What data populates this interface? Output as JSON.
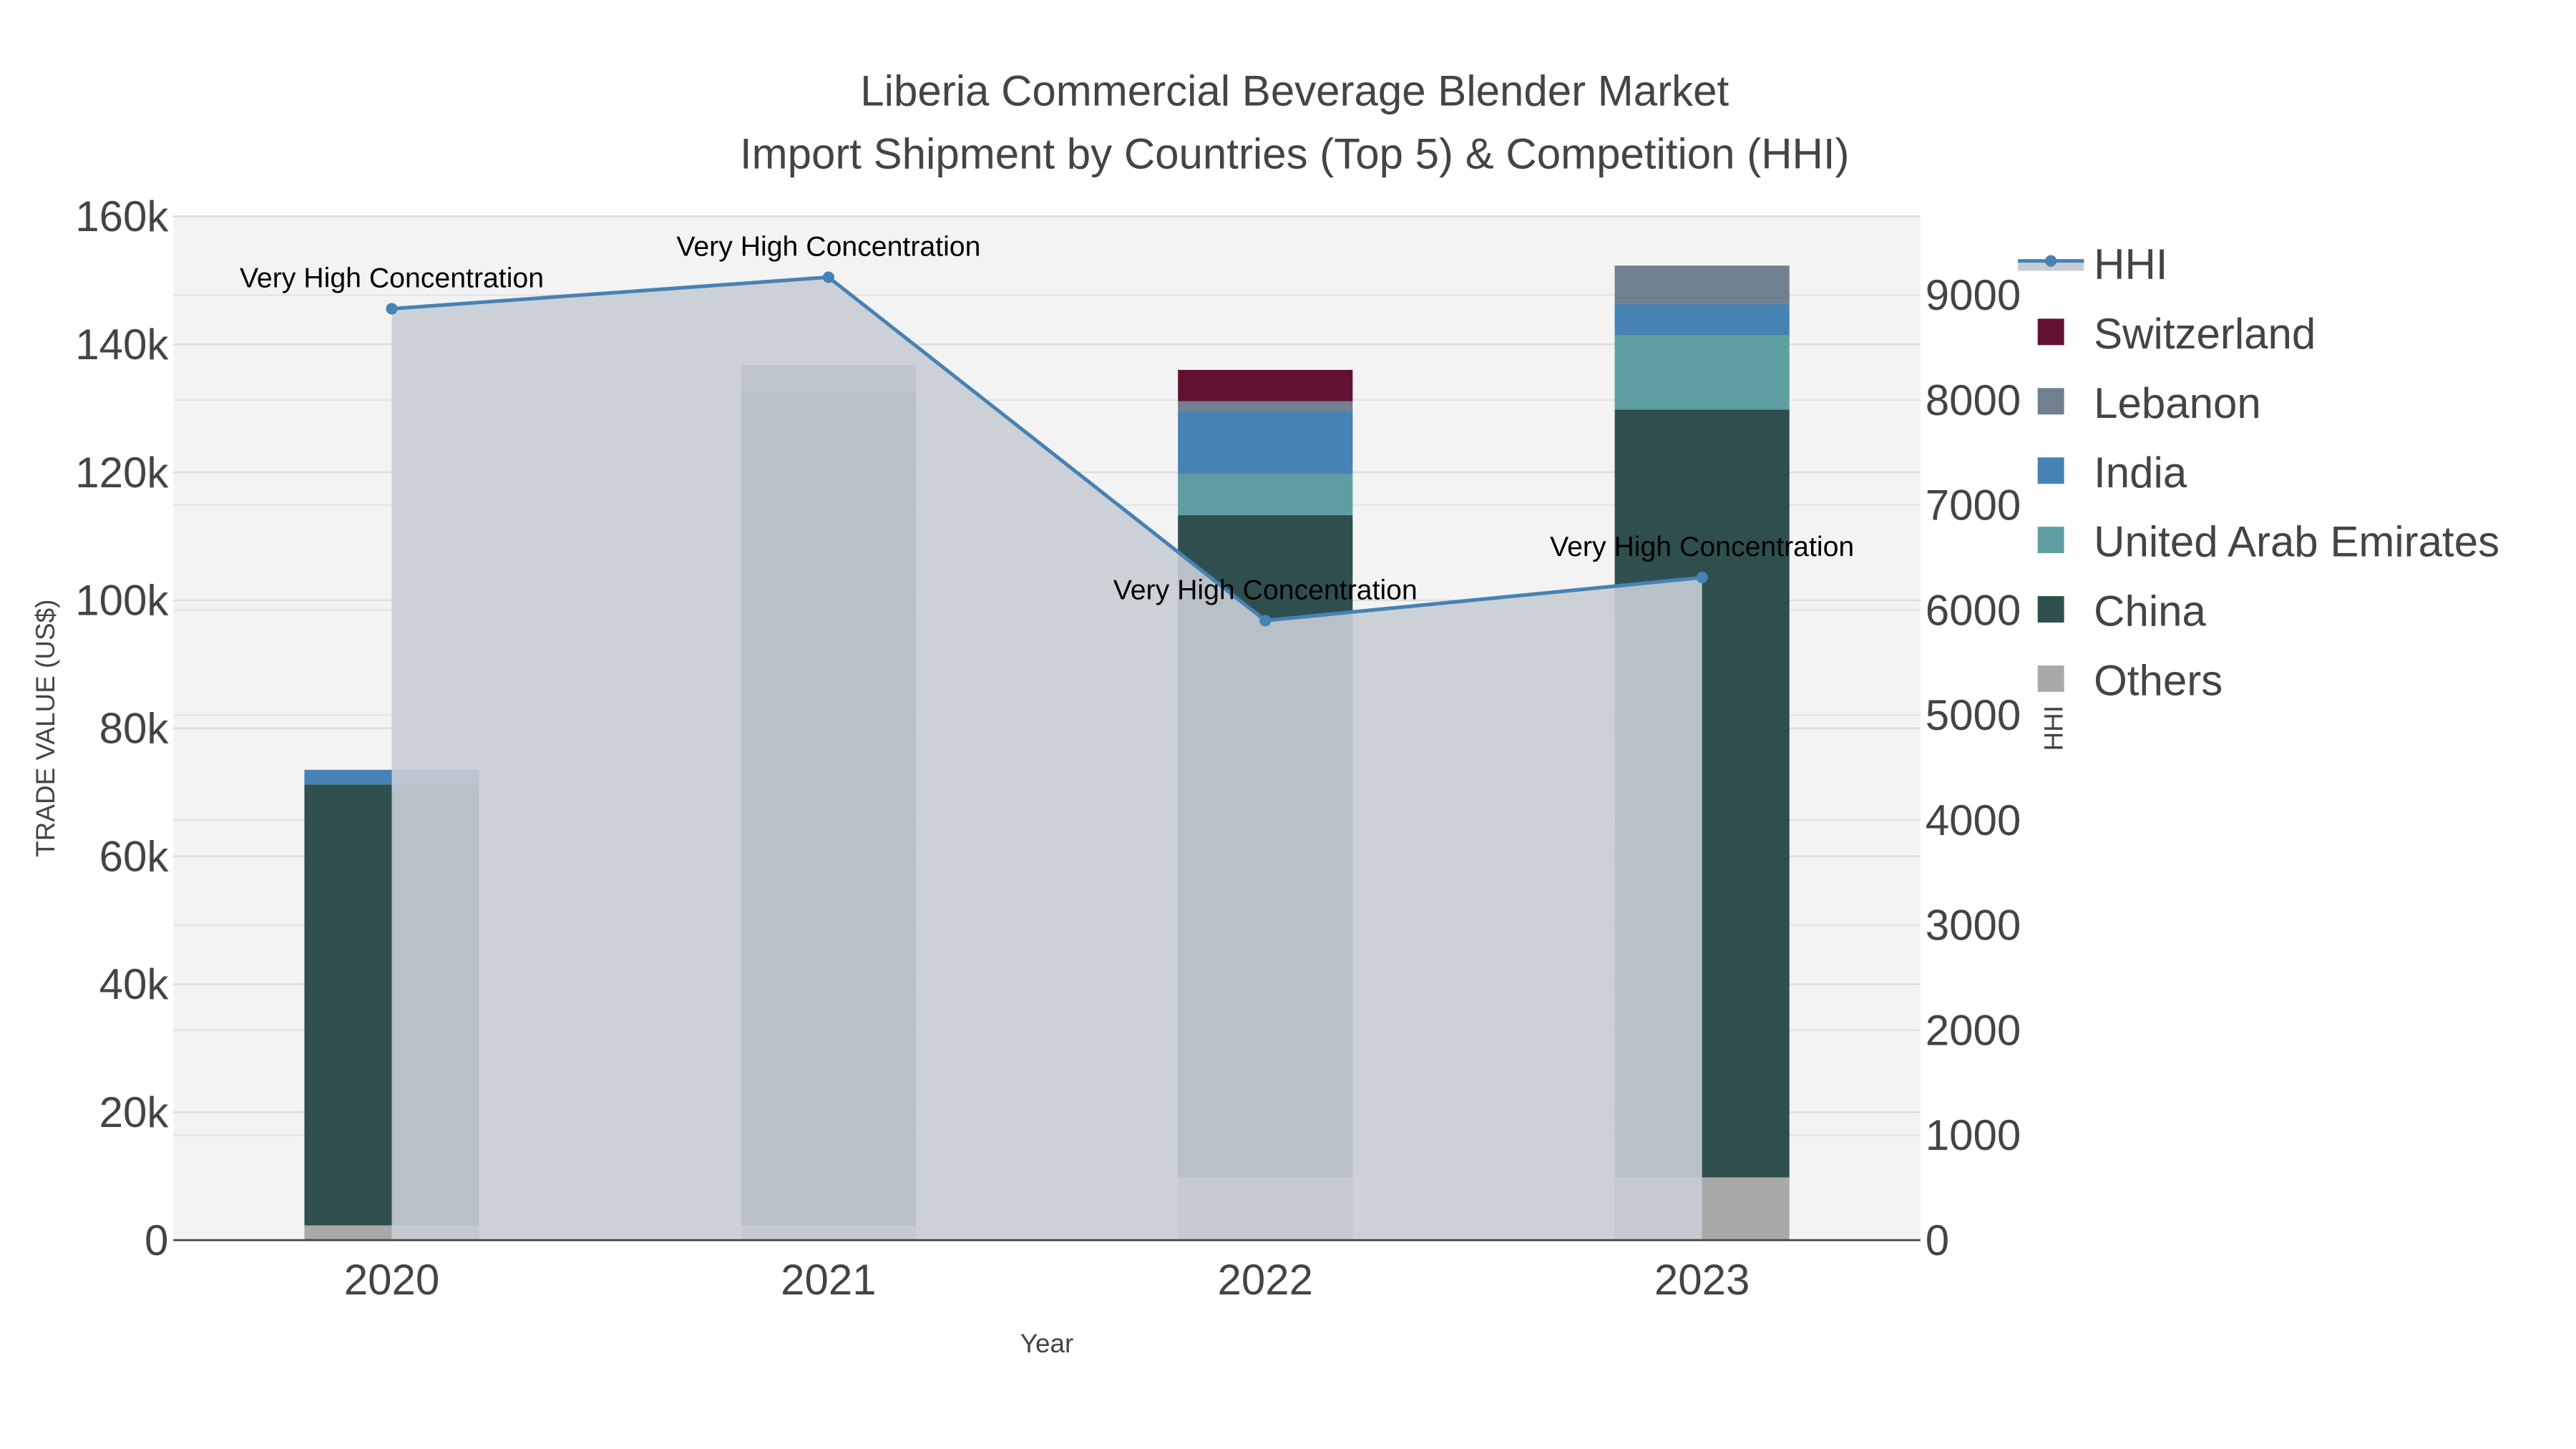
{
  "chart_data": {
    "type": "bar",
    "title": "Liberia Commercial Beverage Blender Market",
    "subtitle": "Import Shipment by Countries (Top 5) & Competition (HHI)",
    "xlabel": "Year",
    "ylabel": "TRADE VALUE (US$)",
    "y2label": "HHI",
    "categories": [
      "2020",
      "2021",
      "2022",
      "2023"
    ],
    "ylim": [
      0,
      160000
    ],
    "y2lim": [
      0,
      9750
    ],
    "yticks": [
      0,
      20000,
      40000,
      60000,
      80000,
      100000,
      120000,
      140000,
      160000
    ],
    "ytick_labels": [
      "0",
      "20k",
      "40k",
      "60k",
      "80k",
      "100k",
      "120k",
      "140k",
      "160k"
    ],
    "y2ticks": [
      0,
      1000,
      2000,
      3000,
      4000,
      5000,
      6000,
      7000,
      8000,
      9000
    ],
    "y2tick_labels": [
      "0",
      "1000",
      "2000",
      "3000",
      "4000",
      "5000",
      "6000",
      "7000",
      "8000",
      "9000"
    ],
    "stacked": true,
    "grid": true,
    "legend_position": "right",
    "series": [
      {
        "name": "Others",
        "color": "#A9A9A9",
        "values": [
          2300,
          2300,
          9800,
          9800
        ]
      },
      {
        "name": "China",
        "color": "#2F4F4F",
        "values": [
          68900,
          130300,
          103500,
          120000
        ]
      },
      {
        "name": "United Arab Emirates",
        "color": "#5F9EA0",
        "values": [
          0,
          500,
          6400,
          11600
        ]
      },
      {
        "name": "India",
        "color": "#4682B4",
        "values": [
          2300,
          1100,
          9800,
          4900
        ]
      },
      {
        "name": "Lebanon",
        "color": "#708090",
        "values": [
          0,
          2600,
          1600,
          6000
        ]
      },
      {
        "name": "Switzerland",
        "color": "#611132",
        "values": [
          0,
          0,
          4900,
          0
        ]
      }
    ],
    "line": {
      "name": "HHI",
      "color": "#4682B4",
      "fill_color": "#C8CDD4",
      "values": [
        8870,
        9170,
        5900,
        6310
      ],
      "annotations": [
        "Very High Concentration",
        "Very High Concentration",
        "Very High Concentration",
        "Very High Concentration"
      ]
    },
    "legend_order": [
      "HHI",
      "Switzerland",
      "Lebanon",
      "India",
      "United Arab Emirates",
      "China",
      "Others"
    ]
  }
}
